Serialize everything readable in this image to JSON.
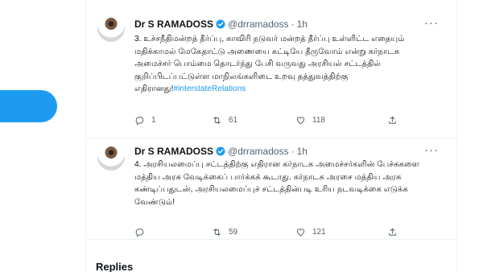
{
  "tweets": [
    {
      "name": "Dr S RAMADOSS",
      "handle": "@drramadoss",
      "separator": "·",
      "time": "1h",
      "more": "···",
      "text": "3. உச்சநீதிமன்றத் தீர்ப்பு, காவிரி நடுவர் மன்றத் தீர்ப்பு உள்ளிட்ட எதையும் மதிக்காமல் மேகேதாட்டு அணையை கட்டியே தீருவோம் என்று கர்நாடக அமைச்சர் பொம்மை தொடர்ந்து பேசி வருவது அரசியல் சட்டத்தில் குறிப்பிடப்பட்டுள்ள மாநிலங்களிடை உறவு தத்துவத்திற்கு எதிரானது!",
      "hashtag": "#interstateRelations",
      "replies": "1",
      "retweets": "61",
      "likes": "118"
    },
    {
      "name": "Dr S RAMADOSS",
      "handle": "@drramadoss",
      "separator": "·",
      "time": "1h",
      "more": "···",
      "text": "4. அரசியலமைப்பு சட்டத்திற்கு எதிரான கர்நாடக அமைச்சர்களின் பேச்சுகளை மத்திய அரசு வேடிக்கைப் பார்க்கக் கூடாது. கர்நாடக அரசை மத்திய அரசு கண்டிப்பதுடன், அரசியலமைப்புச் சட்டத்தின்படி உரிய நடவடிக்கை எடுக்க வேண்டும்!",
      "hashtag": "",
      "replies": "",
      "retweets": "59",
      "likes": "121"
    }
  ],
  "replies_heading": "Replies",
  "icons": {
    "verified": "verified-badge-icon",
    "reply": "reply-icon",
    "retweet": "retweet-icon",
    "like": "heart-icon",
    "share": "share-icon"
  },
  "colors": {
    "accent": "#1d9bf0",
    "text": "#0f1419",
    "secondary": "#536471",
    "divider": "#eff3f4"
  }
}
